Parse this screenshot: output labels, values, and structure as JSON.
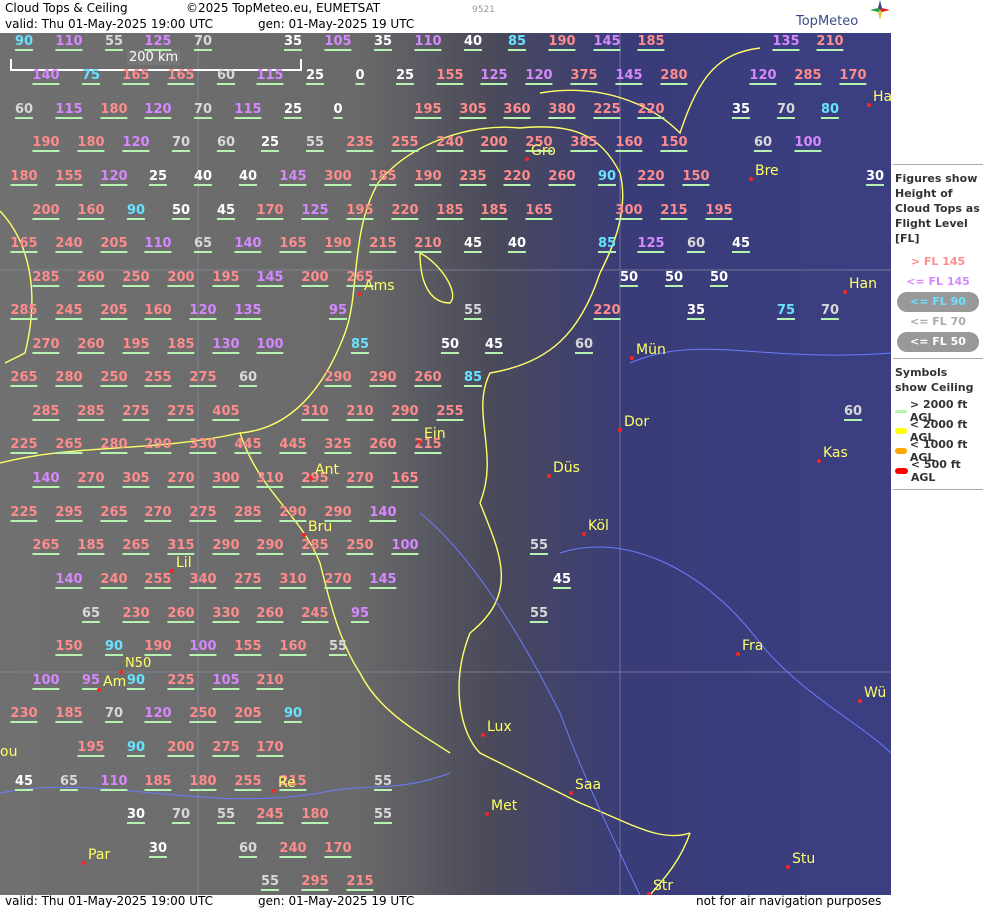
{
  "header": {
    "title": "Cloud Tops & Ceiling",
    "copyright": "©2025 TopMeteo.eu, EUMETSAT",
    "valid": "valid:  Thu  01-May-2025  19:00 UTC",
    "gen": "gen: 01-May-2025 19 UTC",
    "code": "9521",
    "brand": "TopMeteo"
  },
  "footer": {
    "valid": "valid:  Thu  01-May-2025  19:00 UTC",
    "gen": "gen: 01-May-2025 19 UTC",
    "disclaimer": "not for air navigation purposes"
  },
  "scale_label": "200 km",
  "latitude_label": "N50",
  "legend": {
    "title": "Figures show Height of Cloud Tops as Flight Level  [FL]",
    "items": [
      "> FL 145",
      "<= FL 145",
      "<= FL 90",
      "<= FL 70",
      "<= FL 50"
    ],
    "symbols_title": "Symbols show Ceiling",
    "symbols": [
      {
        "label": "> 2000 ft AGL",
        "color": "#b6f2b0"
      },
      {
        "label": "< 2000 ft AGL",
        "color": "#ffff00"
      },
      {
        "label": "< 1000 ft AGL",
        "color": "#ffa500"
      },
      {
        "label": "< 500 ft AGL",
        "color": "#ff0000"
      }
    ]
  },
  "cities": [
    "Gro",
    "Bre",
    "Ams",
    "Han",
    "Mün",
    "Dor",
    "Ein",
    "Ant",
    "Düs",
    "Kas",
    "Bru",
    "Köl",
    "Lil",
    "Fra",
    "Am",
    "Wü",
    "Lux",
    "Saa",
    "Re",
    "Met",
    "Par",
    "Stu",
    "Str",
    "Ha",
    "ou"
  ],
  "rows": [
    [
      "90",
      "110",
      "55",
      "125",
      "70",
      "35",
      "105",
      "35",
      "110",
      "40",
      "85",
      "190",
      "145",
      "185",
      "135",
      "210"
    ],
    [
      "140",
      "75",
      "165",
      "165",
      "60",
      "115",
      "25",
      "0",
      "25",
      "155",
      "125",
      "120",
      "375",
      "145",
      "280",
      "120",
      "285",
      "170"
    ],
    [
      "60",
      "115",
      "180",
      "120",
      "70",
      "115",
      "25",
      "0",
      "195",
      "305",
      "360",
      "380",
      "225",
      "220",
      "35",
      "70",
      "80"
    ],
    [
      "190",
      "180",
      "120",
      "70",
      "60",
      "25",
      "55",
      "235",
      "255",
      "240",
      "200",
      "250",
      "385",
      "160",
      "150",
      "60",
      "100"
    ],
    [
      "180",
      "155",
      "120",
      "25",
      "40",
      "40",
      "145",
      "300",
      "185",
      "190",
      "235",
      "220",
      "260",
      "90",
      "220",
      "150",
      "30"
    ],
    [
      "200",
      "160",
      "90",
      "50",
      "45",
      "170",
      "125",
      "195",
      "220",
      "185",
      "185",
      "165",
      "300",
      "215",
      "195"
    ],
    [
      "165",
      "240",
      "205",
      "110",
      "65",
      "140",
      "165",
      "190",
      "215",
      "210",
      "45",
      "40",
      "85",
      "125",
      "60",
      "45"
    ],
    [
      "285",
      "260",
      "250",
      "200",
      "195",
      "145",
      "200",
      "265",
      "50",
      "50",
      "50"
    ],
    [
      "285",
      "245",
      "205",
      "160",
      "120",
      "135",
      "95",
      "55",
      "220",
      "35",
      "75",
      "70"
    ],
    [
      "270",
      "260",
      "195",
      "185",
      "130",
      "100",
      "85",
      "50",
      "45",
      "60"
    ],
    [
      "265",
      "280",
      "250",
      "255",
      "275",
      "60",
      "290",
      "290",
      "260",
      "85"
    ],
    [
      "285",
      "285",
      "275",
      "275",
      "405",
      "310",
      "210",
      "290",
      "255",
      "60"
    ],
    [
      "225",
      "265",
      "280",
      "290",
      "330",
      "445",
      "445",
      "325",
      "260",
      "215"
    ],
    [
      "140",
      "270",
      "305",
      "270",
      "300",
      "310",
      "295",
      "270",
      "165"
    ],
    [
      "225",
      "295",
      "265",
      "270",
      "275",
      "285",
      "290",
      "290",
      "140"
    ],
    [
      "265",
      "185",
      "265",
      "315",
      "290",
      "290",
      "285",
      "250",
      "100",
      "55"
    ],
    [
      "140",
      "240",
      "255",
      "340",
      "275",
      "310",
      "270",
      "145",
      "45"
    ],
    [
      "65",
      "230",
      "260",
      "330",
      "260",
      "245",
      "95",
      "55"
    ],
    [
      "150",
      "90",
      "190",
      "100",
      "155",
      "160",
      "55"
    ],
    [
      "100",
      "95",
      "90",
      "225",
      "105",
      "210"
    ],
    [
      "230",
      "185",
      "70",
      "120",
      "250",
      "205",
      "90"
    ],
    [
      "195",
      "90",
      "200",
      "275",
      "170"
    ],
    [
      "45",
      "65",
      "110",
      "185",
      "180",
      "255",
      "215",
      "55"
    ],
    [
      "30",
      "70",
      "55",
      "245",
      "180",
      "55"
    ],
    [
      "30",
      "60",
      "240",
      "170"
    ],
    [
      "55",
      "295",
      "215"
    ]
  ]
}
